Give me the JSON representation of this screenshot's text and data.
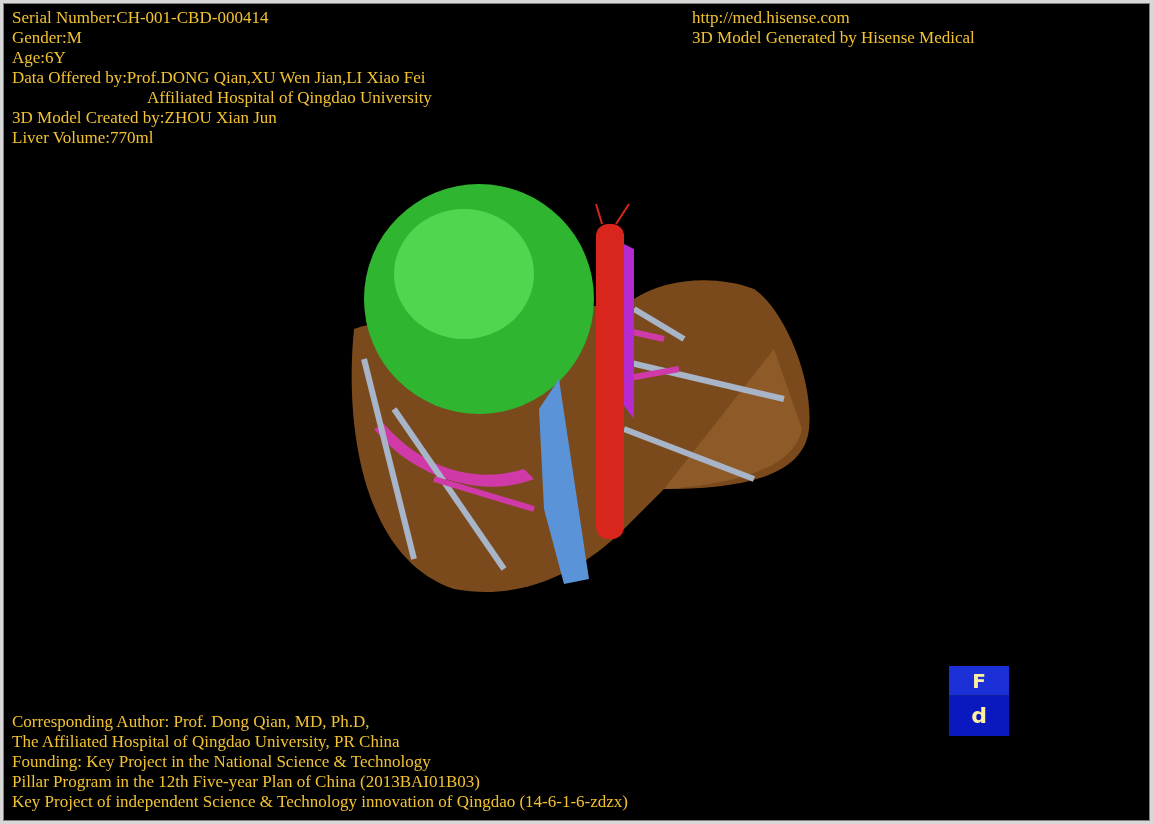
{
  "case_info": [
    {
      "text": "Serial Number:CH-001-CBD-000414",
      "indented": false
    },
    {
      "text": "Gender:M",
      "indented": false
    },
    {
      "text": "Age:6Y",
      "indented": false
    },
    {
      "text": "Data Offered by:Prof.DONG Qian,XU Wen Jian,LI Xiao Fei",
      "indented": false
    },
    {
      "text": "Affiliated Hospital of Qingdao University",
      "indented": true
    },
    {
      "text": "3D Model Created by:ZHOU Xian Jun",
      "indented": false
    },
    {
      "text": "Liver Volume:770ml",
      "indented": false
    }
  ],
  "vendor_info": [
    "http://med.hisense.com",
    "3D Model Generated by Hisense Medical"
  ],
  "orientation_cube": {
    "top_label": "F",
    "front_label": "d"
  },
  "credits": [
    "Corresponding Author: Prof. Dong Qian, MD, Ph.D,",
    "The Affiliated Hospital of Qingdao University, PR China",
    "Founding: Key Project in the National Science & Technology",
    "Pillar Program in the 12th Five-year Plan of China (2013BAI01B03)",
    "Key Project of independent Science & Technology innovation of Qingdao (14-6-1-6-zdzx)"
  ]
}
